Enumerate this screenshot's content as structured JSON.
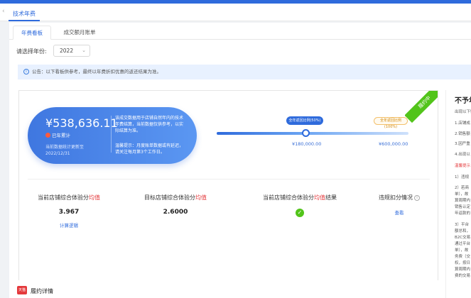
{
  "tabs": {
    "main_tab": "技术年费",
    "back_icon": "chevron-left-icon"
  },
  "subtabs": [
    "年费看板",
    "成交额月账单"
  ],
  "filter": {
    "label": "请选择年份:",
    "year": "2022"
  },
  "notice": "公告：以下看板供参考，最终以年费折扣优惠的返还结果为准。",
  "status_ribbon": "履约中",
  "summary": {
    "amount": "¥538,636.11",
    "badge_label": "已年累计",
    "stat_note_line1": "当前数据统计更新至",
    "stat_note_line2": "2022/12/31",
    "description": "该成交数据用于店铺自然年内的技术年费结算，当前数据仅供参考，以实际结算为准。",
    "tip": "温馨提示：月度账单数据或有延迟，请关注每月第3个工作日。"
  },
  "progress": {
    "tag_current": "全年返回比例(50%)",
    "tag_target": "全年返回比例(100%)",
    "value_1": "¥180,000.00",
    "value_2": "¥600,000.00",
    "fill_fraction": 0.45
  },
  "metrics": [
    {
      "title_prefix": "当前店铺综合体验分",
      "title_hi": "均值",
      "title_suffix": "",
      "value": "3.967",
      "link": "计算逻辑"
    },
    {
      "title_prefix": "目标店铺综合体验分",
      "title_hi": "均值",
      "title_suffix": "",
      "value": "2.6000"
    },
    {
      "title_prefix": "当前店铺综合体验分",
      "title_hi": "均值",
      "title_suffix": "结果",
      "value": "✓"
    },
    {
      "title_prefix": "违规扣分情况",
      "title_hi": "",
      "title_suffix": "",
      "link": "查看"
    }
  ],
  "side_panel": {
    "heading": "不予年费",
    "lines": [
      "出现以下情",
      "1.店铺成",
      "2.销售额",
      "3.因严重",
      "4.出现以",
      "温馨提示",
      "1）违规",
      "2）若商",
      "单），故",
      "算周期内",
      "销售认定",
      "年返款的",
      "3）平台",
      "额总和，",
      "B2C交易",
      "通过平台",
      "单），故",
      "务费（交",
      "权，按日",
      "算周期内",
      "费的交易"
    ]
  },
  "footer": {
    "icon_label": "天猫",
    "title": "履约详情"
  },
  "colors": {
    "accent": "#2f6bdc",
    "success": "#52c41a",
    "highlight": "#e4393c"
  }
}
